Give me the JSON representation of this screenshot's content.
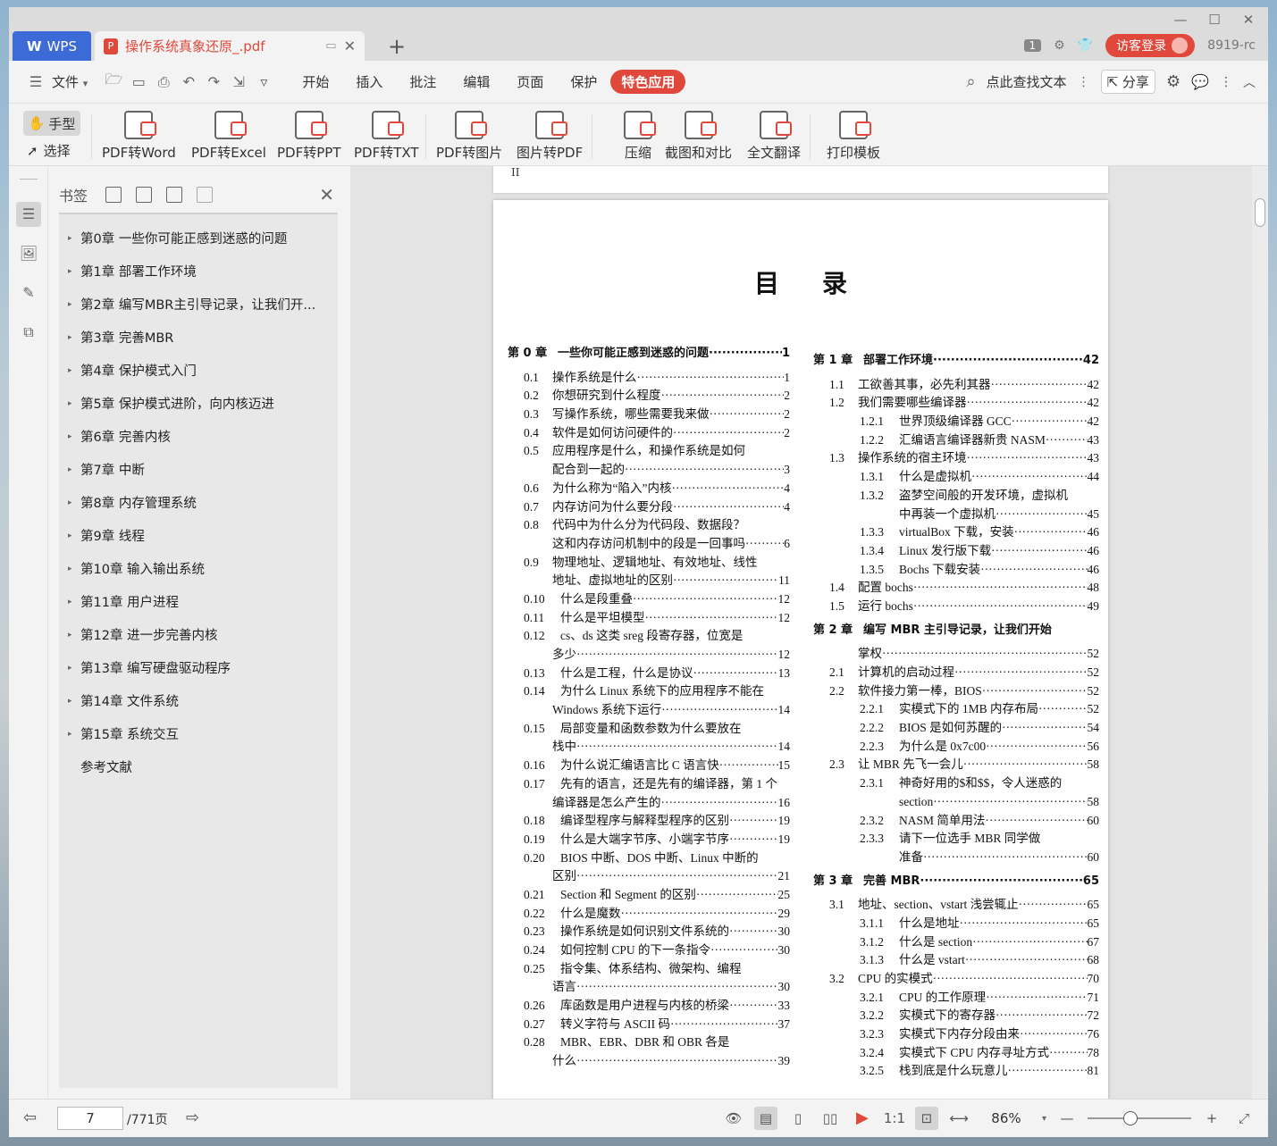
{
  "window": {
    "app_tab": "WPS",
    "doc_tab": "操作系统真象还原_.pdf",
    "page_badge": "1",
    "login_label": "访客登录",
    "user_code": "8919-rc"
  },
  "menu": {
    "file": "文件",
    "items": [
      "开始",
      "插入",
      "批注",
      "编辑",
      "页面",
      "保护"
    ],
    "active": "特色应用",
    "search_label": "点此查找文本",
    "share": "分享"
  },
  "ribbon": {
    "hand": "手型",
    "select": "选择",
    "tools": [
      "PDF转Word",
      "PDF转Excel",
      "PDF转PPT",
      "PDF转TXT",
      "PDF转图片",
      "图片转PDF",
      "压缩",
      "截图和对比",
      "全文翻译",
      "打印模板"
    ]
  },
  "bookmarks": {
    "title": "书签",
    "items": [
      "第0章  一些你可能正感到迷惑的问题",
      "第1章  部署工作环境",
      "第2章  编写MBR主引导记录，让我们开...",
      "第3章  完善MBR",
      "第4章  保护模式入门",
      "第5章  保护模式进阶，向内核迈进",
      "第6章  完善内核",
      "第7章  中断",
      "第8章  内存管理系统",
      "第9章  线程",
      "第10章  输入输出系统",
      "第11章  用户进程",
      "第12章  进一步完善内核",
      "第13章  编写硬盘驱动程序",
      "第14章  文件系统",
      "第15章  系统交互",
      "参考文献"
    ]
  },
  "page": {
    "prev_page_mark": "II",
    "title": "目录",
    "left": [
      {
        "k": "ch",
        "num": "第 0 章",
        "txt": "一些你可能正感到迷惑的问题",
        "pg": "1"
      },
      {
        "k": "l1",
        "num": "0.1",
        "txt": "操作系统是什么",
        "pg": "1"
      },
      {
        "k": "l1",
        "num": "0.2",
        "txt": "你想研究到什么程度",
        "pg": "2"
      },
      {
        "k": "l1",
        "num": "0.3",
        "txt": "写操作系统，哪些需要我来做",
        "pg": "2"
      },
      {
        "k": "l1",
        "num": "0.4",
        "txt": "软件是如何访问硬件的",
        "pg": "2"
      },
      {
        "k": "l1",
        "num": "0.5",
        "txt": "应用程序是什么，和操作系统是如何",
        "pg": ""
      },
      {
        "k": "cont",
        "num": "",
        "txt": "配合到一起的",
        "pg": "3"
      },
      {
        "k": "l1",
        "num": "0.6",
        "txt": "为什么称为“陷入”内核",
        "pg": "4"
      },
      {
        "k": "l1",
        "num": "0.7",
        "txt": "内存访问为什么要分段",
        "pg": "4"
      },
      {
        "k": "l1",
        "num": "0.8",
        "txt": "代码中为什么分为代码段、数据段？",
        "pg": ""
      },
      {
        "k": "cont",
        "num": "",
        "txt": "这和内存访问机制中的段是一回事吗",
        "pg": "6"
      },
      {
        "k": "l1",
        "num": "0.9",
        "txt": "物理地址、逻辑地址、有效地址、线性",
        "pg": ""
      },
      {
        "k": "cont",
        "num": "",
        "txt": "地址、虚拟地址的区别",
        "pg": "11"
      },
      {
        "k": "l1 w",
        "num": "0.10",
        "txt": "什么是段重叠",
        "pg": "12"
      },
      {
        "k": "l1 w",
        "num": "0.11",
        "txt": "什么是平坦模型",
        "pg": "12"
      },
      {
        "k": "l1 w",
        "num": "0.12",
        "txt": "cs、ds 这类 sreg 段寄存器，位宽是",
        "pg": ""
      },
      {
        "k": "cont",
        "num": "",
        "txt": "多少",
        "pg": "12"
      },
      {
        "k": "l1 w",
        "num": "0.13",
        "txt": "什么是工程，什么是协议",
        "pg": "13"
      },
      {
        "k": "l1 w",
        "num": "0.14",
        "txt": "为什么 Linux 系统下的应用程序不能在",
        "pg": ""
      },
      {
        "k": "cont",
        "num": "",
        "txt": "Windows 系统下运行",
        "pg": "14"
      },
      {
        "k": "l1 w",
        "num": "0.15",
        "txt": "局部变量和函数参数为什么要放在",
        "pg": ""
      },
      {
        "k": "cont",
        "num": "",
        "txt": "栈中",
        "pg": "14"
      },
      {
        "k": "l1 w",
        "num": "0.16",
        "txt": "为什么说汇编语言比 C 语言快",
        "pg": "15"
      },
      {
        "k": "l1 w",
        "num": "0.17",
        "txt": "先有的语言，还是先有的编译器，第 1 个",
        "pg": ""
      },
      {
        "k": "cont",
        "num": "",
        "txt": "编译器是怎么产生的",
        "pg": "16"
      },
      {
        "k": "l1 w",
        "num": "0.18",
        "txt": "编译型程序与解释型程序的区别",
        "pg": "19"
      },
      {
        "k": "l1 w",
        "num": "0.19",
        "txt": "什么是大端字节序、小端字节序",
        "pg": "19"
      },
      {
        "k": "l1 w",
        "num": "0.20",
        "txt": "BIOS 中断、DOS 中断、Linux 中断的",
        "pg": ""
      },
      {
        "k": "cont",
        "num": "",
        "txt": "区别",
        "pg": "21"
      },
      {
        "k": "l1 w",
        "num": "0.21",
        "txt": "Section 和 Segment 的区别",
        "pg": "25"
      },
      {
        "k": "l1 w",
        "num": "0.22",
        "txt": "什么是魔数",
        "pg": "29"
      },
      {
        "k": "l1 w",
        "num": "0.23",
        "txt": "操作系统是如何识别文件系统的",
        "pg": "30"
      },
      {
        "k": "l1 w",
        "num": "0.24",
        "txt": "如何控制 CPU 的下一条指令",
        "pg": "30"
      },
      {
        "k": "l1 w",
        "num": "0.25",
        "txt": "指令集、体系结构、微架构、编程",
        "pg": ""
      },
      {
        "k": "cont",
        "num": "",
        "txt": "语言",
        "pg": "30"
      },
      {
        "k": "l1 w",
        "num": "0.26",
        "txt": "库函数是用户进程与内核的桥梁",
        "pg": "33"
      },
      {
        "k": "l1 w",
        "num": "0.27",
        "txt": "转义字符与 ASCII 码",
        "pg": "37"
      },
      {
        "k": "l1 w",
        "num": "0.28",
        "txt": "MBR、EBR、DBR 和 OBR 各是",
        "pg": ""
      },
      {
        "k": "cont",
        "num": "",
        "txt": "什么",
        "pg": "39"
      }
    ],
    "right": [
      {
        "k": "ch",
        "num": "第 1 章",
        "txt": "部署工作环境",
        "pg": "42"
      },
      {
        "k": "l1",
        "num": "1.1",
        "txt": "工欲善其事，必先利其器",
        "pg": "42"
      },
      {
        "k": "l1",
        "num": "1.2",
        "txt": "我们需要哪些编译器",
        "pg": "42"
      },
      {
        "k": "l2",
        "num": "1.2.1",
        "txt": "世界顶级编译器 GCC",
        "pg": "42"
      },
      {
        "k": "l2",
        "num": "1.2.2",
        "txt": "汇编语言编译器新贵 NASM",
        "pg": "43"
      },
      {
        "k": "l1",
        "num": "1.3",
        "txt": "操作系统的宿主环境",
        "pg": "43"
      },
      {
        "k": "l2",
        "num": "1.3.1",
        "txt": "什么是虚拟机",
        "pg": "44"
      },
      {
        "k": "l2",
        "num": "1.3.2",
        "txt": "盗梦空间般的开发环境，虚拟机",
        "pg": ""
      },
      {
        "k": "cont2",
        "num": "",
        "txt": "中再装一个虚拟机",
        "pg": "45"
      },
      {
        "k": "l2",
        "num": "1.3.3",
        "txt": "virtualBox 下载，安装",
        "pg": "46"
      },
      {
        "k": "l2",
        "num": "1.3.4",
        "txt": "Linux 发行版下载",
        "pg": "46"
      },
      {
        "k": "l2",
        "num": "1.3.5",
        "txt": "Bochs 下载安装",
        "pg": "46"
      },
      {
        "k": "l1",
        "num": "1.4",
        "txt": "配置 bochs",
        "pg": "48"
      },
      {
        "k": "l1",
        "num": "1.5",
        "txt": "运行 bochs",
        "pg": "49"
      },
      {
        "k": "ch",
        "num": "第 2 章",
        "txt": "编写 MBR 主引导记录，让我们开始",
        "pg": ""
      },
      {
        "k": "cont",
        "num": "",
        "txt": "掌权",
        "pg": "52"
      },
      {
        "k": "l1",
        "num": "2.1",
        "txt": "计算机的启动过程",
        "pg": "52"
      },
      {
        "k": "l1",
        "num": "2.2",
        "txt": "软件接力第一棒，BIOS",
        "pg": "52"
      },
      {
        "k": "l2",
        "num": "2.2.1",
        "txt": "实模式下的 1MB 内存布局",
        "pg": "52"
      },
      {
        "k": "l2",
        "num": "2.2.2",
        "txt": "BIOS 是如何苏醒的",
        "pg": "54"
      },
      {
        "k": "l2",
        "num": "2.2.3",
        "txt": "为什么是 0x7c00",
        "pg": "56"
      },
      {
        "k": "l1",
        "num": "2.3",
        "txt": "让 MBR 先飞一会儿",
        "pg": "58"
      },
      {
        "k": "l2",
        "num": "2.3.1",
        "txt": "神奇好用的$和$$，令人迷惑的",
        "pg": ""
      },
      {
        "k": "cont2",
        "num": "",
        "txt": "section",
        "pg": "58"
      },
      {
        "k": "l2",
        "num": "2.3.2",
        "txt": "NASM 简单用法",
        "pg": "60"
      },
      {
        "k": "l2",
        "num": "2.3.3",
        "txt": "请下一位选手 MBR 同学做",
        "pg": ""
      },
      {
        "k": "cont2",
        "num": "",
        "txt": "准备",
        "pg": "60"
      },
      {
        "k": "ch",
        "num": "第 3 章",
        "txt": "完善 MBR",
        "pg": "65"
      },
      {
        "k": "l1",
        "num": "3.1",
        "txt": "地址、section、vstart 浅尝辄止",
        "pg": "65"
      },
      {
        "k": "l2",
        "num": "3.1.1",
        "txt": "什么是地址",
        "pg": "65"
      },
      {
        "k": "l2",
        "num": "3.1.2",
        "txt": "什么是 section",
        "pg": "67"
      },
      {
        "k": "l2",
        "num": "3.1.3",
        "txt": "什么是 vstart",
        "pg": "68"
      },
      {
        "k": "l1",
        "num": "3.2",
        "txt": "CPU 的实模式",
        "pg": "70"
      },
      {
        "k": "l2",
        "num": "3.2.1",
        "txt": "CPU 的工作原理",
        "pg": "71"
      },
      {
        "k": "l2",
        "num": "3.2.2",
        "txt": "实模式下的寄存器",
        "pg": "72"
      },
      {
        "k": "l2",
        "num": "3.2.3",
        "txt": "实模式下内存分段由来",
        "pg": "76"
      },
      {
        "k": "l2",
        "num": "3.2.4",
        "txt": "实模式下 CPU 内存寻址方式",
        "pg": "78"
      },
      {
        "k": "l2",
        "num": "3.2.5",
        "txt": "栈到底是什么玩意儿",
        "pg": "81"
      }
    ]
  },
  "status": {
    "page_current": "7",
    "page_total": "/771页",
    "zoom": "86%",
    "zoom_level_percent": 86
  }
}
